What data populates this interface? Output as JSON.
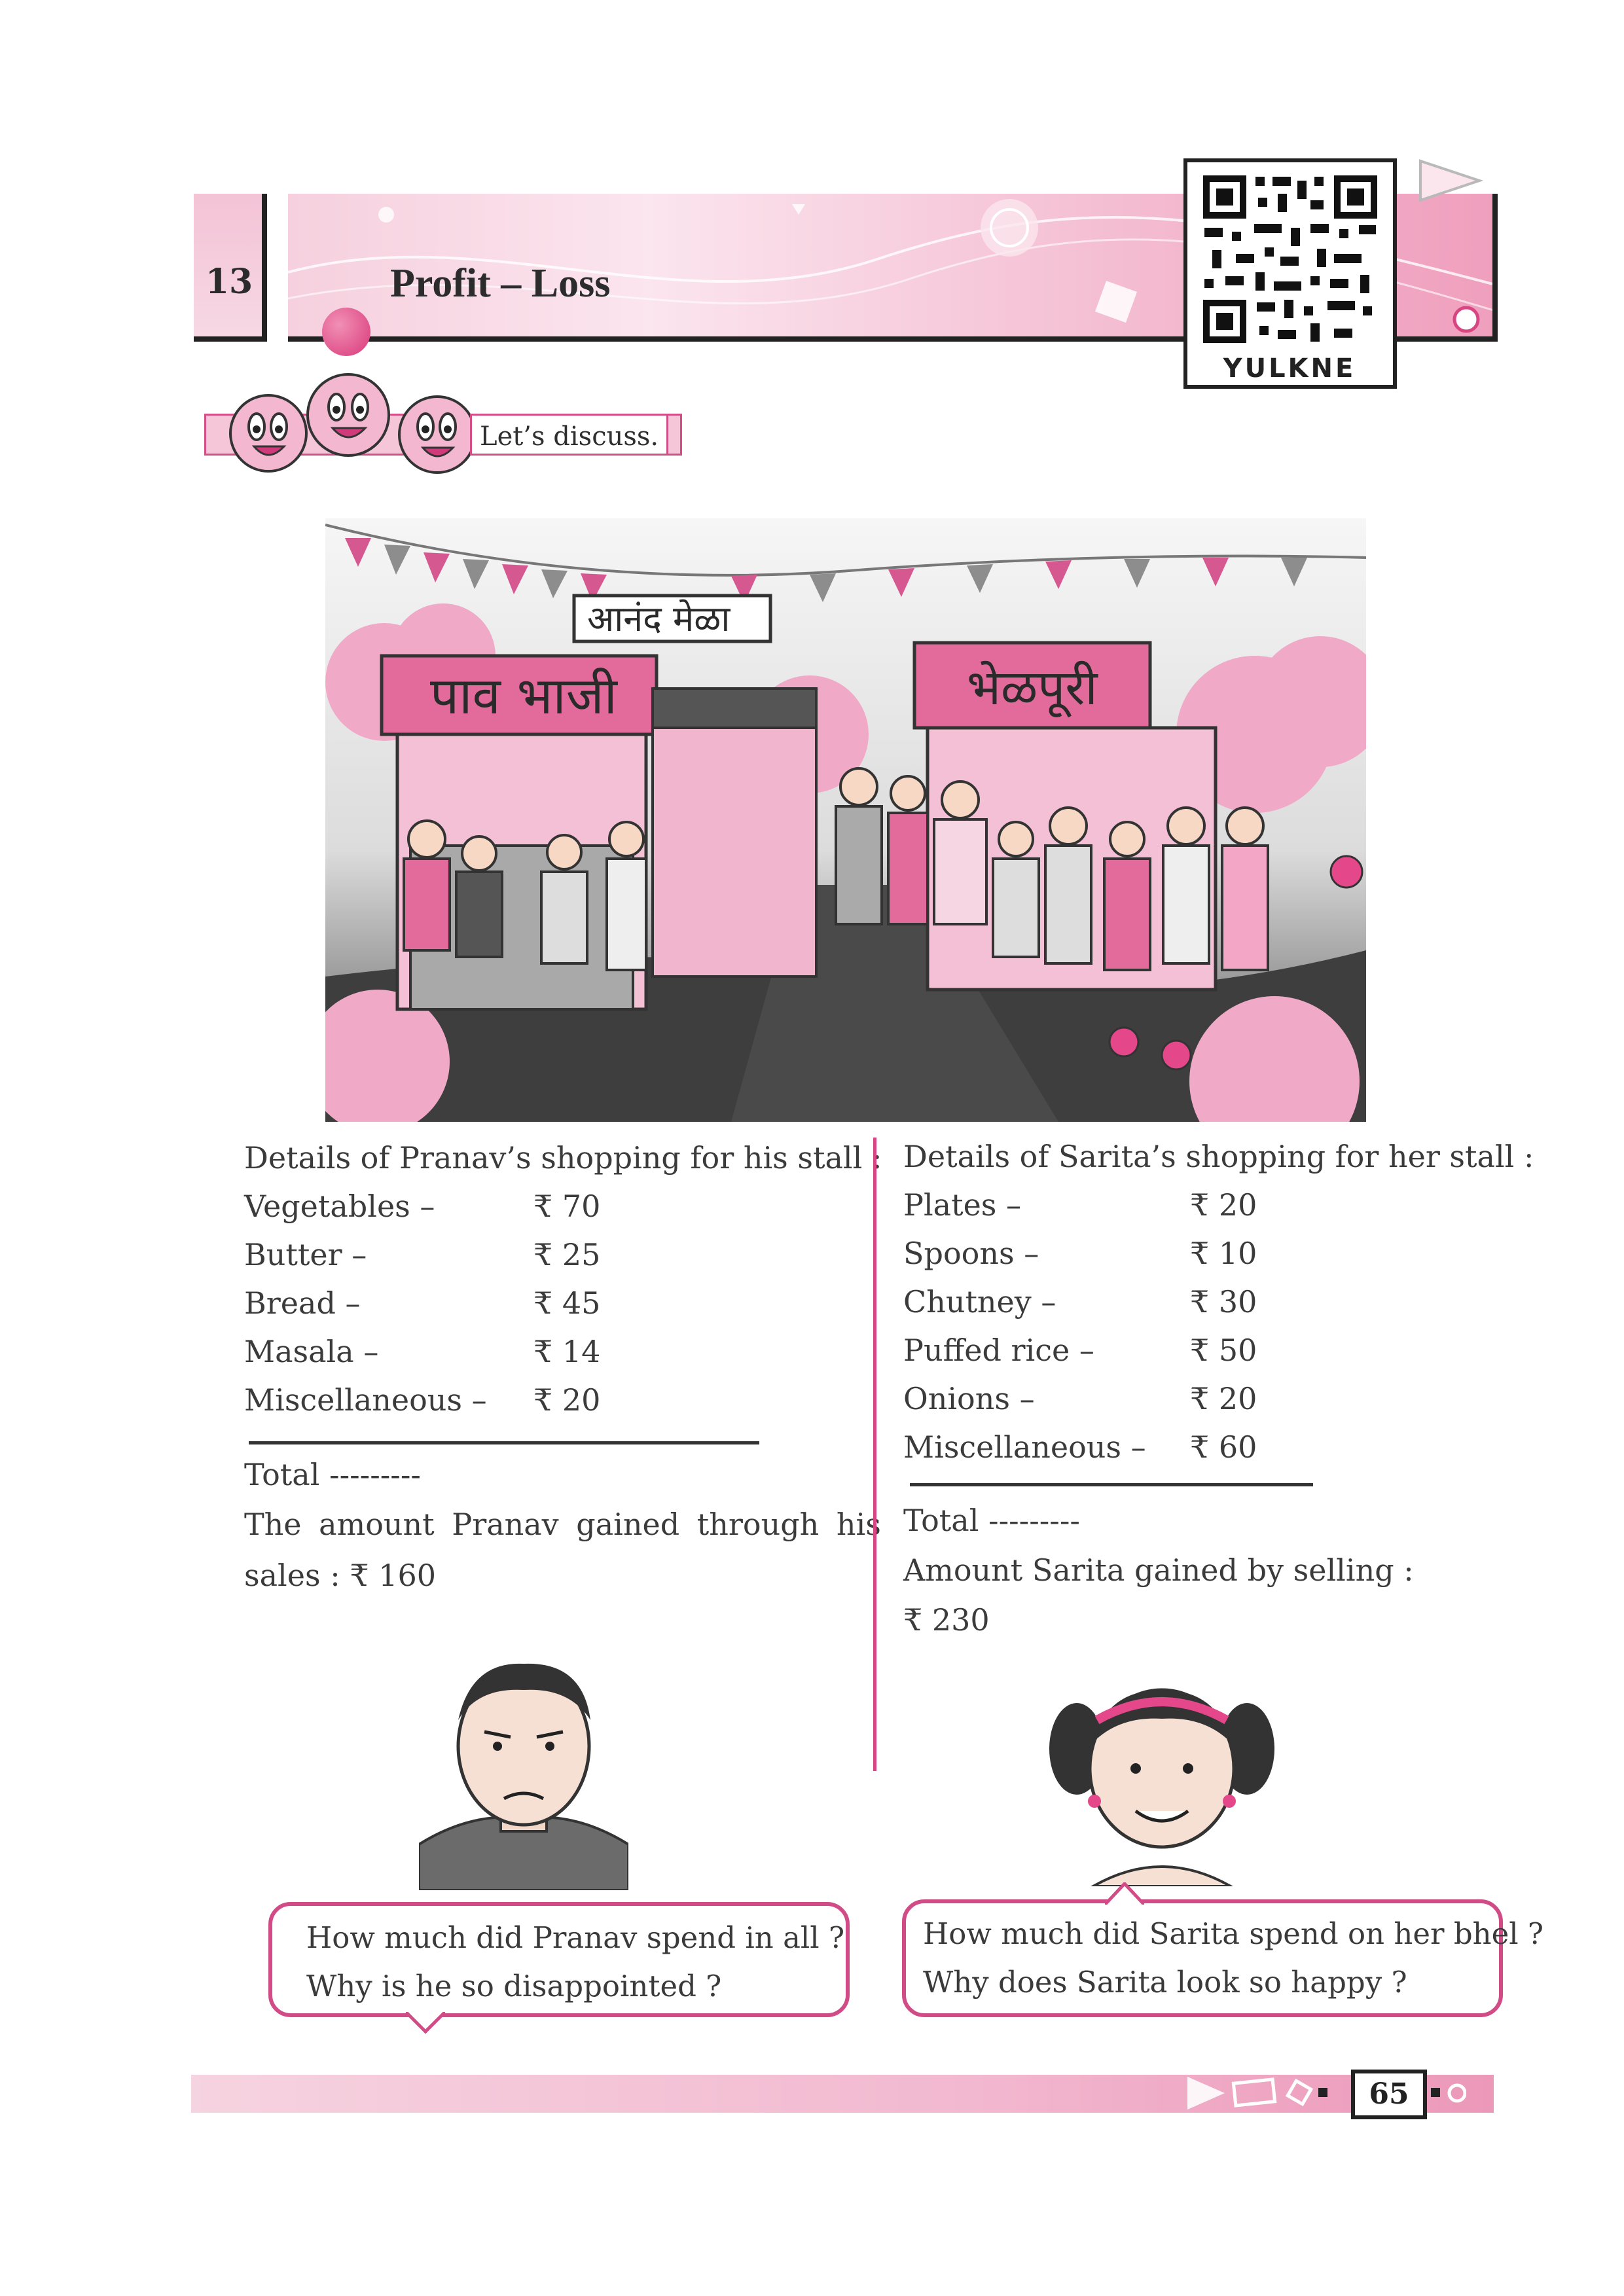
{
  "header": {
    "chapter_number": "13",
    "chapter_title": "Profit – Loss",
    "qr_caption": "YULKNE"
  },
  "discuss": {
    "label": "Let’s discuss."
  },
  "illustration": {
    "banner_top": "आनंद मेळा",
    "stall_left": "पाव भाजी",
    "stall_right": "भेळपूरी"
  },
  "pranav": {
    "heading": "Details of Pranav’s shopping for his stall :",
    "items": [
      {
        "name": "Vegetables –",
        "price": "₹ 70"
      },
      {
        "name": "Butter –",
        "price": "₹ 25"
      },
      {
        "name": "Bread –",
        "price": "₹ 45"
      },
      {
        "name": "Masala –",
        "price": "₹ 14"
      },
      {
        "name": "Miscellaneous –",
        "price": "₹ 20"
      }
    ],
    "total_label": "Total ---------",
    "gain_line1": "The amount Pranav gained through his",
    "gain_line2": "sales : ₹ 160"
  },
  "sarita": {
    "heading": "Details of Sarita’s shopping for her stall :",
    "items": [
      {
        "name": "Plates –",
        "price": "₹ 20"
      },
      {
        "name": "Spoons –",
        "price": "₹ 10"
      },
      {
        "name": "Chutney –",
        "price": "₹ 30"
      },
      {
        "name": "Puffed rice –",
        "price": "₹ 50"
      },
      {
        "name": "Onions –",
        "price": "₹ 20"
      },
      {
        "name": "Miscellaneous –",
        "price": "₹ 60"
      }
    ],
    "total_label": "Total ---------",
    "gain_line1": "Amount Sarita gained by selling :",
    "gain_line2": "₹ 230"
  },
  "bubbles": {
    "pranav_line1": "How much did Pranav spend in all ?",
    "pranav_line2": "Why is he so disappointed ?",
    "sarita_line1": "How much did Sarita spend on her bhel ?",
    "sarita_line2": "Why does Sarita look so happy ?"
  },
  "footer": {
    "page_number": "65"
  },
  "colors": {
    "accent_pink": "#d74583",
    "light_pink": "#f5c6d8"
  }
}
